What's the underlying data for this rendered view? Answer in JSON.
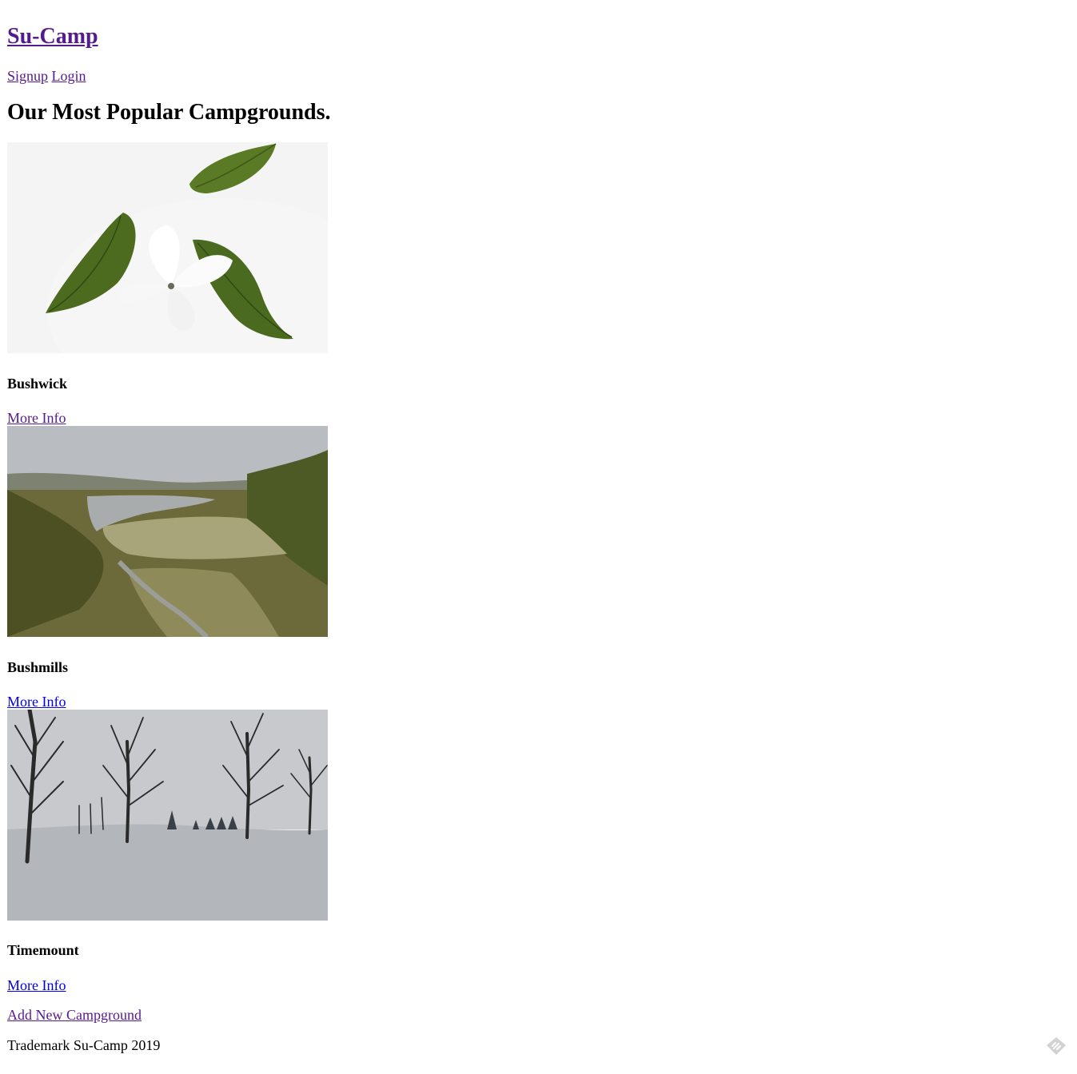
{
  "header": {
    "brand": "Su-Camp",
    "nav": {
      "signup": "Signup",
      "login": "Login"
    }
  },
  "main": {
    "heading": "Our Most Popular Campgrounds.",
    "campgrounds": [
      {
        "name": "Bushwick",
        "link_label": "More Info",
        "image": "flower-leaves-photo"
      },
      {
        "name": "Bushmills",
        "link_label": "More Info",
        "image": "lake-valley-photo"
      },
      {
        "name": "Timemount",
        "link_label": "More Info",
        "image": "snowy-trees-photo"
      }
    ],
    "add_link": "Add New Campground"
  },
  "footer": {
    "text": "Trademark Su-Camp 2019"
  },
  "colors": {
    "visited_link": "#551a8b",
    "link": "#0000ee"
  }
}
